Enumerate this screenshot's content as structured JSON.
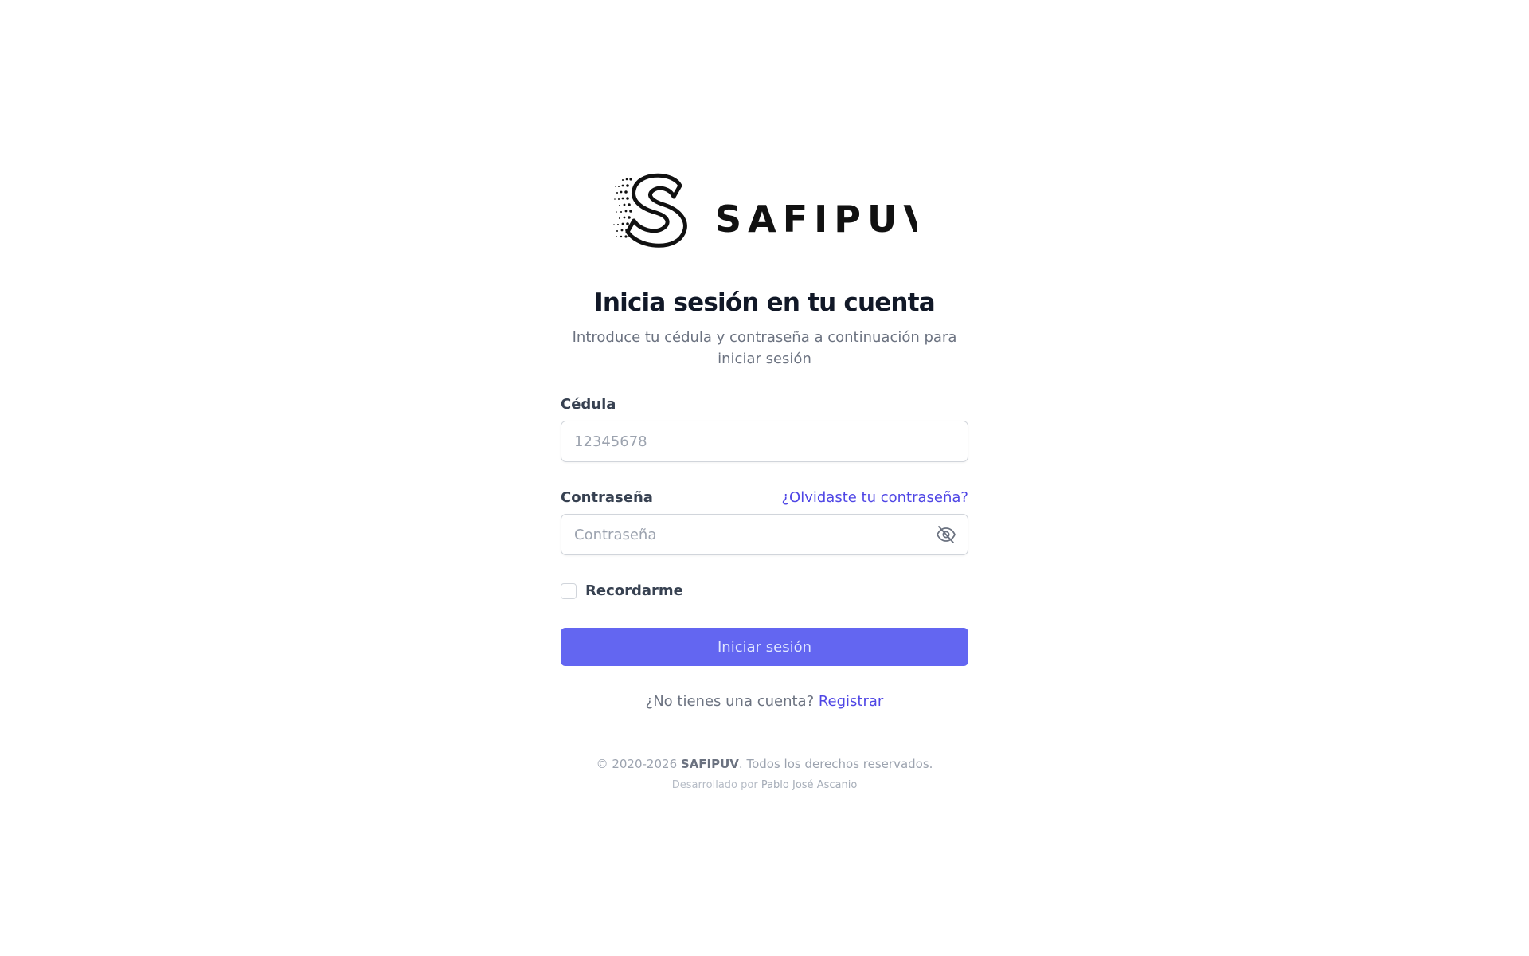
{
  "brand": {
    "name": "SAFIPUV",
    "logo_icon": "s-monogram-icon"
  },
  "header": {
    "title": "Inicia sesión en tu cuenta",
    "subtitle": "Introduce tu cédula y contraseña a continuación para iniciar sesión"
  },
  "form": {
    "cedula": {
      "label": "Cédula",
      "placeholder": "12345678",
      "value": ""
    },
    "password": {
      "label": "Contraseña",
      "placeholder": "Contraseña",
      "value": "",
      "toggle_icon": "eye-off-icon"
    },
    "forgot_link": "¿Olvidaste tu contraseña?",
    "remember": {
      "label": "Recordarme",
      "checked": false
    },
    "submit_label": "Iniciar sesión"
  },
  "register": {
    "prompt": "¿No tienes una cuenta?",
    "link": "Registrar"
  },
  "footer": {
    "copyright_prefix": "© 2020-2026",
    "brand": "SAFIPUV",
    "rights": ". Todos los derechos reservados.",
    "developed_by": "Desarrollado por",
    "author": "Pablo José Ascanio"
  },
  "colors": {
    "primary": "#6366f1",
    "link": "#4f46e5",
    "text_dark": "#111827",
    "text_muted": "#6b7280"
  }
}
